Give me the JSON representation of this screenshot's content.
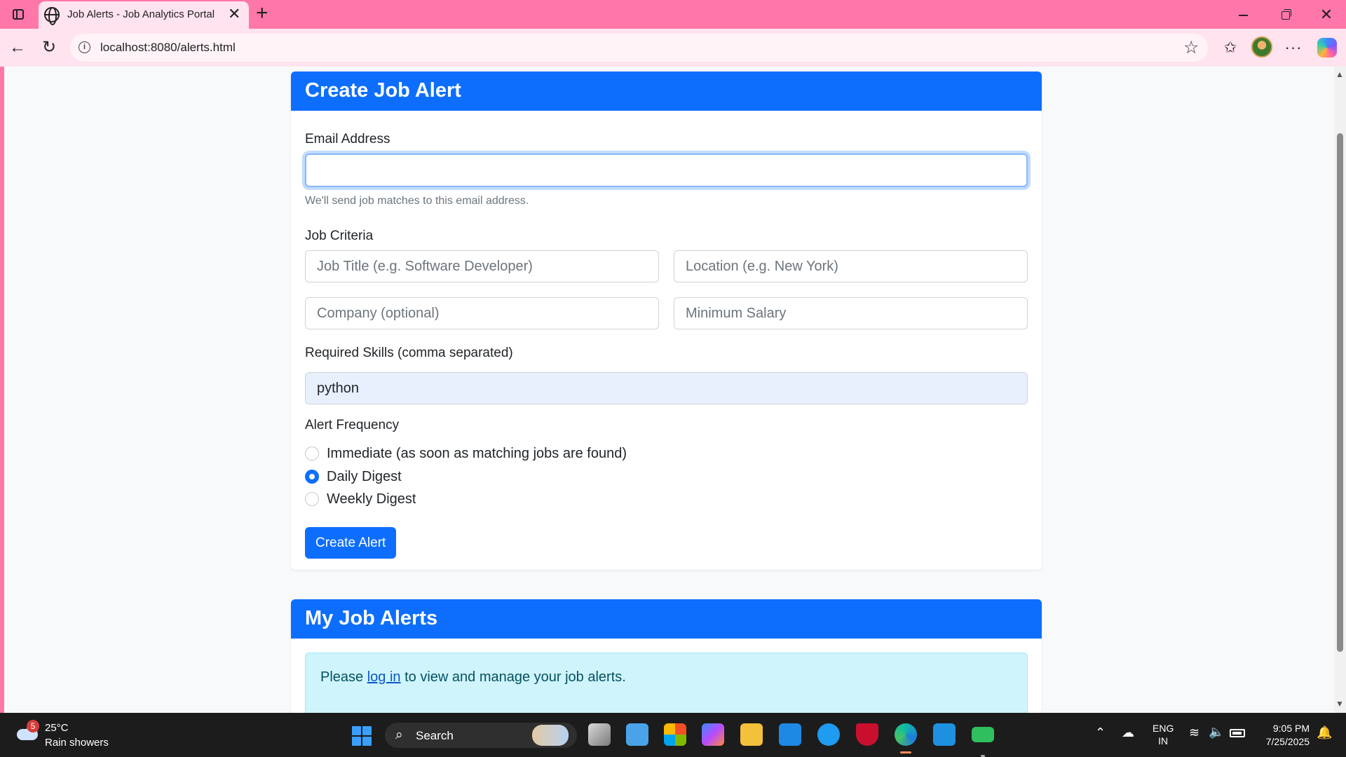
{
  "browser": {
    "tab_title": "Job Alerts - Job Analytics Portal",
    "tab_close": "✕",
    "new_tab": "+",
    "url": "localhost:8080/alerts.html",
    "window_close": "✕"
  },
  "create_alert": {
    "header": "Create Job Alert",
    "email_label": "Email Address",
    "email_value": "",
    "email_help": "We'll send job matches to this email address.",
    "criteria_label": "Job Criteria",
    "job_title_placeholder": "Job Title (e.g. Software Developer)",
    "location_placeholder": "Location (e.g. New York)",
    "company_placeholder": "Company (optional)",
    "salary_placeholder": "Minimum Salary",
    "skills_label": "Required Skills (comma separated)",
    "skills_value": "python",
    "frequency_label": "Alert Frequency",
    "frequency_options": [
      {
        "label": "Immediate (as soon as matching jobs are found)",
        "checked": false
      },
      {
        "label": "Daily Digest",
        "checked": true
      },
      {
        "label": "Weekly Digest",
        "checked": false
      }
    ],
    "submit_label": "Create Alert"
  },
  "my_alerts": {
    "header": "My Job Alerts",
    "message_prefix": "Please ",
    "login_link": "log in",
    "message_suffix": " to view and manage your job alerts."
  },
  "taskbar": {
    "weather_badge": "5",
    "weather_temp": "25°C",
    "weather_desc": "Rain showers",
    "search_label": "Search",
    "lang_line1": "ENG",
    "lang_line2": "IN",
    "time": "9:05 PM",
    "date": "7/25/2025"
  },
  "colors": {
    "accent": "#0d6efd",
    "browser_frame": "#ff77a9",
    "alert_info_bg": "#cff4fc"
  }
}
